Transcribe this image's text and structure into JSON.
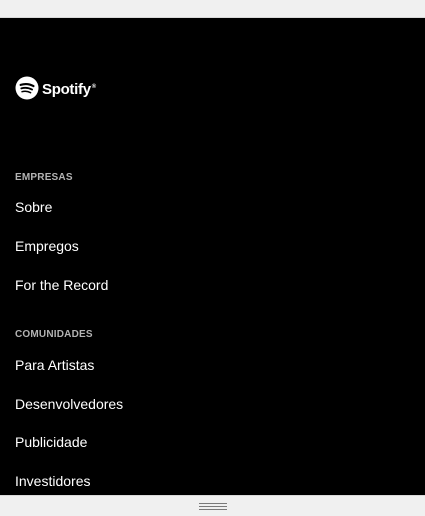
{
  "brand": {
    "name": "Spotify",
    "mark": "®",
    "color": "#ffffff"
  },
  "footer": {
    "sections": [
      {
        "title": "EMPRESAS",
        "links": [
          "Sobre",
          "Empregos",
          "For the Record"
        ]
      },
      {
        "title": "COMUNIDADES",
        "links": [
          "Para Artistas",
          "Desenvolvedores",
          "Publicidade",
          "Investidores"
        ]
      }
    ]
  },
  "colors": {
    "background": "#000000",
    "text": "#ffffff",
    "section_title": "#b3b3b3",
    "chrome": "#f0f0f0"
  }
}
